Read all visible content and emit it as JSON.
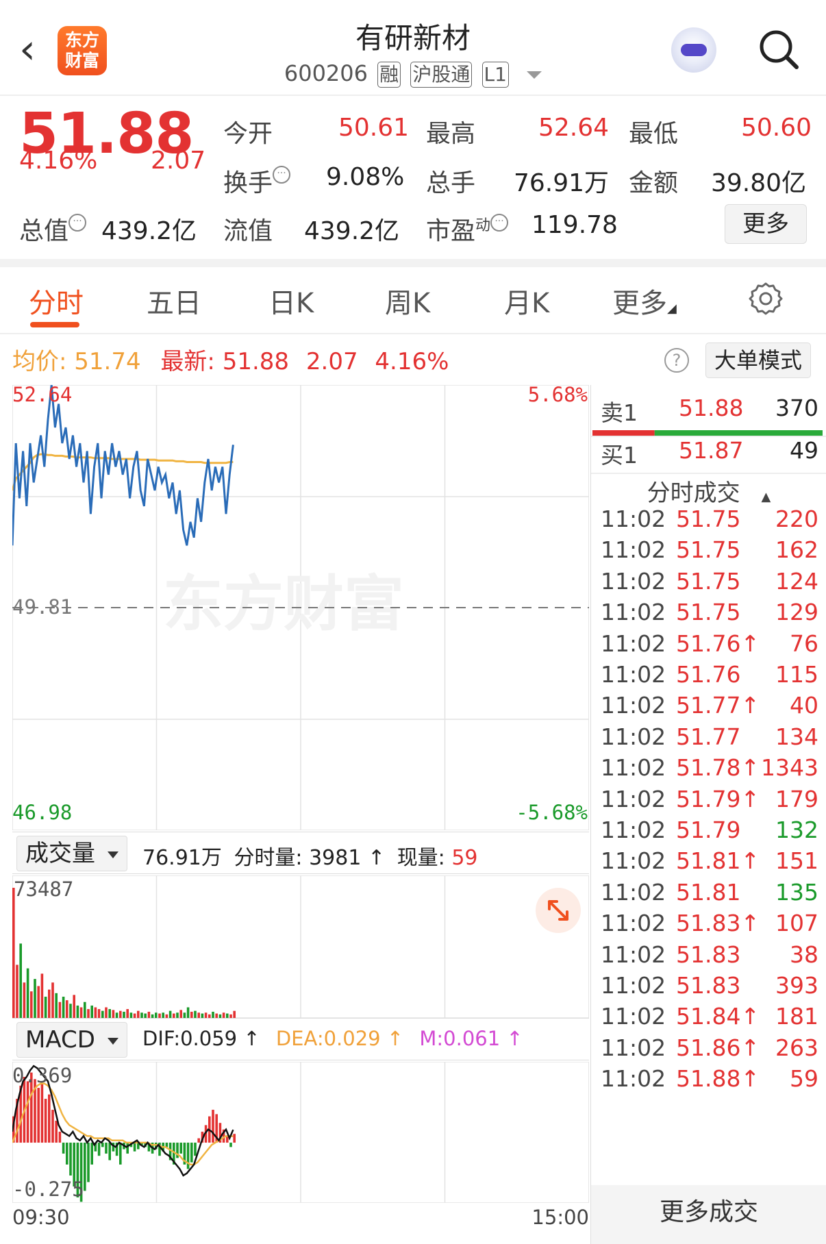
{
  "header": {
    "back_icon": "chevron-left-icon",
    "logo_line1": "东方",
    "logo_line2": "财富",
    "stock_name": "有研新材",
    "stock_code": "600206",
    "tag_margin": "融",
    "tag_connect": "沪股通",
    "tag_level": "L1"
  },
  "quote": {
    "price": "51.88",
    "change_pct": "4.16%",
    "change_amt": "2.07",
    "open_label": "今开",
    "open": "50.61",
    "high_label": "最高",
    "high": "52.64",
    "low_label": "最低",
    "low": "50.60",
    "turnover_label": "换手",
    "turnover": "9.08%",
    "volume_label": "总手",
    "volume": "76.91万",
    "amount_label": "金额",
    "amount": "39.80亿",
    "mktcap_label": "总值",
    "mktcap": "439.2亿",
    "float_label": "流值",
    "float_cap": "439.2亿",
    "pe_label": "市盈",
    "pe_sup": "动",
    "pe": "119.78",
    "more_label": "更多",
    "dots_glyph": "···"
  },
  "tabs": [
    {
      "label": "分时",
      "active": true
    },
    {
      "label": "五日"
    },
    {
      "label": "日K"
    },
    {
      "label": "周K"
    },
    {
      "label": "月K"
    },
    {
      "label": "更多"
    }
  ],
  "info": {
    "avg_label": "均价:",
    "avg": "51.74",
    "latest_label": "最新:",
    "latest": "51.88",
    "chg": "2.07",
    "pct": "4.16%",
    "help": "?",
    "big_mode": "大单模式"
  },
  "chart_data": {
    "type": "line",
    "price_high_label": "52.64",
    "price_mid_label": "49.81",
    "price_low_label": "46.98",
    "pct_high_label": "5.68%",
    "pct_low_label": "-5.68%",
    "watermark": "东方财富",
    "ylim": [
      46.98,
      52.64
    ],
    "prev_close": 49.81,
    "series": [
      {
        "values": [
          50.6,
          51.9,
          51.2,
          51.8,
          51.1,
          51.9,
          51.4,
          51.7,
          52.0,
          51.6,
          52.2,
          52.64,
          52.1,
          52.4,
          51.9,
          52.1,
          51.7,
          52.0,
          51.6,
          51.9,
          51.4,
          51.8,
          51.0,
          51.6,
          51.9,
          51.2,
          51.8,
          51.5,
          51.9,
          51.6,
          51.8,
          51.5,
          51.7,
          51.2,
          51.6,
          51.8,
          51.3,
          51.1,
          51.7,
          51.5,
          51.3,
          51.6,
          51.4,
          51.5,
          51.2,
          51.4,
          51.0,
          51.3,
          50.8,
          50.6,
          50.9,
          50.7,
          51.2,
          50.9,
          51.4,
          51.7,
          51.3,
          51.6,
          51.4,
          51.6,
          51.0,
          51.5,
          51.88
        ]
      },
      {
        "values": [
          51.3,
          51.45,
          51.5,
          51.55,
          51.6,
          51.65,
          51.72,
          51.75,
          51.76,
          51.76,
          51.75,
          51.75,
          51.74,
          51.74,
          51.74,
          51.73,
          51.73,
          51.73,
          51.72,
          51.72,
          51.72,
          51.72,
          51.72,
          51.71,
          51.71,
          51.71,
          51.71,
          51.71,
          51.7,
          51.7,
          51.7,
          51.7,
          51.7,
          51.7,
          51.7,
          51.7,
          51.69,
          51.69,
          51.69,
          51.69,
          51.69,
          51.68,
          51.68,
          51.68,
          51.68,
          51.68,
          51.67,
          51.67,
          51.67,
          51.66,
          51.66,
          51.66,
          51.66,
          51.66,
          51.65,
          51.65,
          51.65,
          51.65,
          51.65,
          51.65,
          51.65,
          51.66,
          51.66
        ]
      }
    ],
    "volume": {
      "selector": "成交量",
      "total": "76.91万",
      "minute_label": "分时量:",
      "minute": "3981",
      "up_arrow": "↑",
      "now_label": "现量:",
      "now": "59",
      "max_label": "73487",
      "values": [
        73487,
        30000,
        42000,
        20000,
        28000,
        15000,
        22000,
        18000,
        25000,
        12000,
        16000,
        20000,
        14000,
        9000,
        12000,
        10000,
        8000,
        13000,
        7000,
        6000,
        9000,
        5000,
        7000,
        6000,
        5000,
        4000,
        6000,
        5000,
        4500,
        3000,
        4000,
        3500,
        5000,
        3000,
        2500,
        4000,
        3000,
        2500,
        3500,
        2000,
        3000,
        2500,
        3000,
        2000,
        4000,
        2500,
        3000,
        4500,
        3000,
        6000,
        3500,
        4000,
        3000,
        2500,
        3000,
        2000,
        3500,
        2500,
        2000,
        3000,
        2500,
        2000,
        3981
      ]
    },
    "macd": {
      "selector": "MACD",
      "dif_label": "DIF:0.059 ↑",
      "dea_label": "DEA:0.029 ↑",
      "m_label": "M:0.061 ↑",
      "max_label": "0.369",
      "min_label": "-0.275",
      "ylim": [
        -0.275,
        0.369
      ],
      "bars": [
        0.12,
        0.2,
        0.26,
        0.3,
        0.28,
        0.32,
        0.29,
        0.25,
        0.27,
        0.2,
        0.22,
        0.15,
        0.1,
        0.05,
        -0.05,
        -0.1,
        -0.15,
        -0.2,
        -0.25,
        -0.27,
        -0.22,
        -0.18,
        -0.1,
        -0.04,
        -0.06,
        -0.02,
        -0.05,
        -0.08,
        -0.04,
        -0.06,
        -0.1,
        -0.03,
        -0.05,
        -0.02,
        -0.04,
        -0.03,
        -0.01,
        -0.02,
        -0.04,
        -0.05,
        -0.03,
        -0.06,
        -0.04,
        -0.02,
        -0.08,
        -0.1,
        -0.07,
        -0.05,
        -0.1,
        -0.12,
        -0.09,
        -0.06,
        0.02,
        0.05,
        0.08,
        0.12,
        0.15,
        0.13,
        0.09,
        0.06,
        0.03,
        -0.02,
        0.04
      ],
      "dif": [
        0.05,
        0.15,
        0.22,
        0.28,
        0.3,
        0.33,
        0.35,
        0.34,
        0.32,
        0.3,
        0.28,
        0.22,
        0.15,
        0.08,
        0.05,
        0.04,
        0.03,
        0.05,
        0.02,
        0.01,
        0.03,
        0.0,
        0.02,
        -0.01,
        0.01,
        0.0,
        0.02,
        0.01,
        -0.01,
        -0.02,
        0.0,
        -0.01,
        -0.02,
        -0.01,
        0.0,
        0.01,
        -0.01,
        -0.02,
        0.0,
        -0.02,
        -0.03,
        -0.01,
        -0.03,
        -0.05,
        -0.06,
        -0.08,
        -0.1,
        -0.12,
        -0.15,
        -0.14,
        -0.12,
        -0.1,
        -0.05,
        0.0,
        0.04,
        0.06,
        0.05,
        0.03,
        0.01,
        0.04,
        0.06,
        0.02,
        0.059
      ],
      "dea": [
        0.0,
        0.04,
        0.08,
        0.13,
        0.17,
        0.21,
        0.24,
        0.26,
        0.27,
        0.27,
        0.26,
        0.24,
        0.21,
        0.17,
        0.13,
        0.1,
        0.08,
        0.07,
        0.06,
        0.05,
        0.04,
        0.03,
        0.03,
        0.02,
        0.02,
        0.02,
        0.02,
        0.02,
        0.01,
        0.01,
        0.01,
        0.01,
        0.0,
        0.0,
        0.0,
        0.0,
        0.0,
        0.0,
        0.0,
        -0.01,
        -0.01,
        -0.01,
        -0.02,
        -0.02,
        -0.03,
        -0.04,
        -0.05,
        -0.06,
        -0.08,
        -0.09,
        -0.1,
        -0.1,
        -0.09,
        -0.07,
        -0.05,
        -0.03,
        -0.01,
        0.0,
        0.01,
        0.02,
        0.03,
        0.03,
        0.029
      ]
    },
    "time_start": "09:30",
    "time_end": "15:00",
    "total_points": 241
  },
  "orderbook": {
    "sell_label": "卖1",
    "sell_price": "51.88",
    "sell_vol": "370",
    "buy_label": "买1",
    "buy_price": "51.87",
    "buy_vol": "49",
    "trades_title": "分时成交",
    "more_trades": "更多成交",
    "trades": [
      {
        "time": "11:02",
        "price": "51.75",
        "vol": "220",
        "pcolor": "red",
        "vcolor": "red"
      },
      {
        "time": "11:02",
        "price": "51.75",
        "vol": "162",
        "pcolor": "red",
        "vcolor": "red"
      },
      {
        "time": "11:02",
        "price": "51.75",
        "vol": "124",
        "pcolor": "red",
        "vcolor": "red"
      },
      {
        "time": "11:02",
        "price": "51.75",
        "vol": "129",
        "pcolor": "red",
        "vcolor": "red"
      },
      {
        "time": "11:02",
        "price": "51.76↑",
        "vol": "76",
        "pcolor": "red",
        "vcolor": "red"
      },
      {
        "time": "11:02",
        "price": "51.76",
        "vol": "115",
        "pcolor": "red",
        "vcolor": "red"
      },
      {
        "time": "11:02",
        "price": "51.77↑",
        "vol": "40",
        "pcolor": "red",
        "vcolor": "red"
      },
      {
        "time": "11:02",
        "price": "51.77",
        "vol": "134",
        "pcolor": "red",
        "vcolor": "red"
      },
      {
        "time": "11:02",
        "price": "51.78↑",
        "vol": "1343",
        "pcolor": "red",
        "vcolor": "red"
      },
      {
        "time": "11:02",
        "price": "51.79↑",
        "vol": "179",
        "pcolor": "red",
        "vcolor": "red"
      },
      {
        "time": "11:02",
        "price": "51.79",
        "vol": "132",
        "pcolor": "red",
        "vcolor": "green"
      },
      {
        "time": "11:02",
        "price": "51.81↑",
        "vol": "151",
        "pcolor": "red",
        "vcolor": "red"
      },
      {
        "time": "11:02",
        "price": "51.81",
        "vol": "135",
        "pcolor": "red",
        "vcolor": "green"
      },
      {
        "time": "11:02",
        "price": "51.83↑",
        "vol": "107",
        "pcolor": "red",
        "vcolor": "red"
      },
      {
        "time": "11:02",
        "price": "51.83",
        "vol": "38",
        "pcolor": "red",
        "vcolor": "red"
      },
      {
        "time": "11:02",
        "price": "51.83",
        "vol": "393",
        "pcolor": "red",
        "vcolor": "red"
      },
      {
        "time": "11:02",
        "price": "51.84↑",
        "vol": "181",
        "pcolor": "red",
        "vcolor": "red"
      },
      {
        "time": "11:02",
        "price": "51.86↑",
        "vol": "263",
        "pcolor": "red",
        "vcolor": "red"
      },
      {
        "time": "11:02",
        "price": "51.88↑",
        "vol": "59",
        "pcolor": "red",
        "vcolor": "red"
      }
    ]
  },
  "colors": {
    "up": "#e33232",
    "down": "#1a9a2a",
    "price_line": "#2a6cb8",
    "avg_line": "#f0b442",
    "dif_line": "#111111",
    "dea_line": "#f0b442",
    "accent": "#f0501e"
  }
}
